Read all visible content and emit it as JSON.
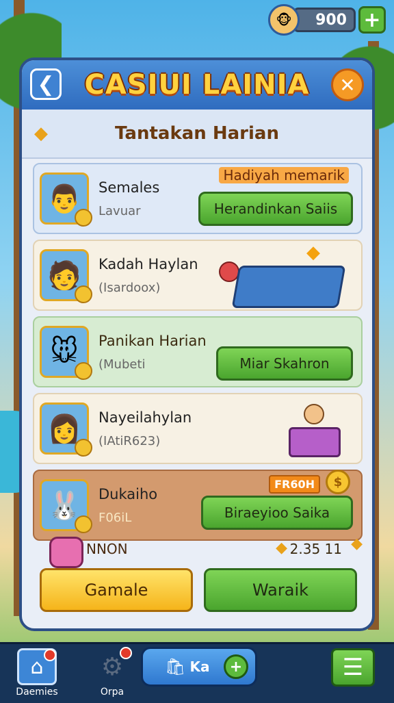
{
  "currency": {
    "amount": "900",
    "avatar_icon": "character-avatar-icon",
    "plus_label": "+"
  },
  "panel": {
    "title": "CASIUI LAINIA",
    "back_label": "❮",
    "close_label": "✕",
    "subtitle": "Tantakan Harian"
  },
  "rows": [
    {
      "name": "Semales",
      "sub": "Lavuar",
      "label": "Hadiyah memarik",
      "button": "Herandinkan Saiis",
      "avatar": "👨"
    },
    {
      "name": "Kadah Haylan",
      "sub": "(Isardoox)",
      "avatar": "🧑"
    },
    {
      "name": "Panikan Harian",
      "sub": "(Mubeti",
      "button": "Miar Skahron",
      "avatar": "🐭"
    },
    {
      "name": "Nayeilahylan",
      "sub": "(IAtiR623)",
      "avatar": "👩"
    },
    {
      "name": "Dukaiho",
      "sub": "F06iL",
      "tag": "FR60H",
      "button": "Biraeyioo Saika",
      "avatar": "🐰"
    }
  ],
  "footer": {
    "name": "NNON",
    "coins": "2.35 11"
  },
  "buttons": {
    "primary": "Gamale",
    "secondary": "Waraik"
  },
  "nav": {
    "home": "Daemies",
    "settings": "Orpa",
    "center": "Ka",
    "center_plus": "+",
    "menu_icon": "☰"
  },
  "colors": {
    "header_blue": "#2f6cbf",
    "title_yellow": "#ffd23f",
    "accent_green": "#4aa52e",
    "accent_orange": "#f59a25",
    "nav_dark": "#173458"
  }
}
